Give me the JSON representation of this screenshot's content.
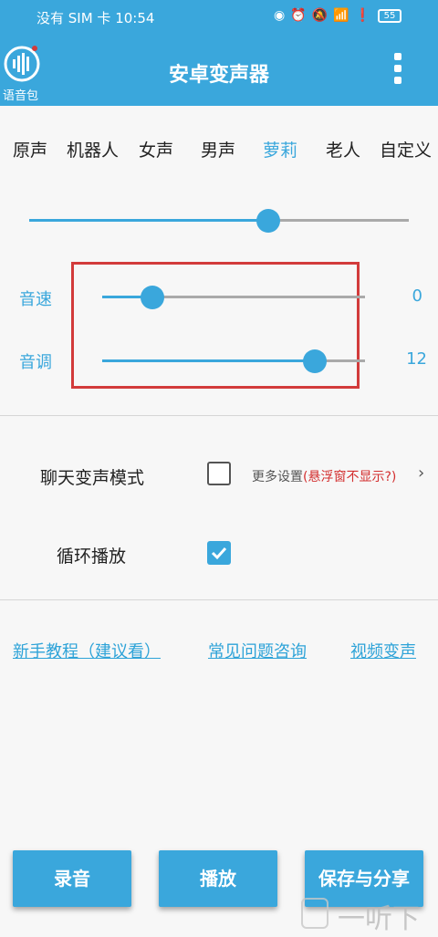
{
  "status_bar": {
    "carrier_time": "没有 SIM 卡 10:54",
    "battery": "55"
  },
  "app_bar": {
    "logo_label": "语音包",
    "title": "安卓变声器"
  },
  "presets": {
    "items": [
      "原声",
      "机器人",
      "女声",
      "男声",
      "萝莉",
      "老人",
      "自定义"
    ],
    "selected": "萝莉"
  },
  "preset_slider": {
    "level": 0.63
  },
  "sliders": {
    "speed": {
      "label": "音速",
      "value": "0",
      "level": 0.19
    },
    "pitch": {
      "label": "音调",
      "value": "12",
      "level": 0.81
    }
  },
  "options": {
    "chat_mode": {
      "label": "聊天变声模式",
      "checked": false
    },
    "loop_play": {
      "label": "循环播放",
      "checked": true
    },
    "more_settings": "更多设置",
    "more_settings_warn": "(悬浮窗不显示?)"
  },
  "links": [
    "新手教程（建议看）",
    "常见问题咨询",
    "视频变声"
  ],
  "buttons": {
    "record": "录音",
    "play": "播放",
    "save_share": "保存与分享"
  },
  "watermark": "一听下载",
  "colors": {
    "accent": "#3aa7dc",
    "highlight_box": "#d23b3b",
    "warning": "#d32f2f"
  }
}
